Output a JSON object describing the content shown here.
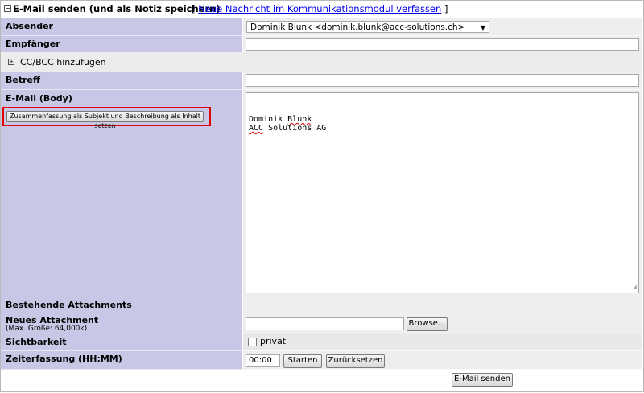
{
  "header": {
    "title": "E-Mail senden (und als Notiz speichern)",
    "bracket_open": "[",
    "link": "Neue Nachricht im Kommunikationsmodul verfassen",
    "bracket_close": "]"
  },
  "fields": {
    "sender_label": "Absender",
    "sender_value": "Dominik Blunk <dominik.blunk@acc-solutions.ch>",
    "recipient_label": "Empfänger",
    "cc_bcc_label": "CC/BCC hinzufügen",
    "subject_label": "Betreff",
    "body_label": "E-Mail (Body)",
    "summary_button": "Zusammenfassung als Subjekt und Beschreibung als Inhalt setzen",
    "body_line1_a": "Dominik ",
    "body_line1_b": "Blunk",
    "body_line2_a": "ACC",
    "body_line2_b": " Solutions AG",
    "existing_attachments_label": "Bestehende Attachments",
    "new_attachment_label": "Neues Attachment",
    "new_attachment_hint": "(Max. Größe: 64,000k)",
    "browse_button": "Browse...",
    "visibility_label": "Sichtbarkeit",
    "private_label": "privat",
    "time_label": "Zeiterfassung (HH:MM)",
    "time_value": "00:00",
    "start_button": "Starten",
    "reset_button": "Zurücksetzen",
    "send_button": "E-Mail senden"
  },
  "colors": {
    "label_bg": "#c8c8e6",
    "value_bg": "#eeeeee",
    "highlight": "#e00000",
    "link": "#0000ee"
  }
}
